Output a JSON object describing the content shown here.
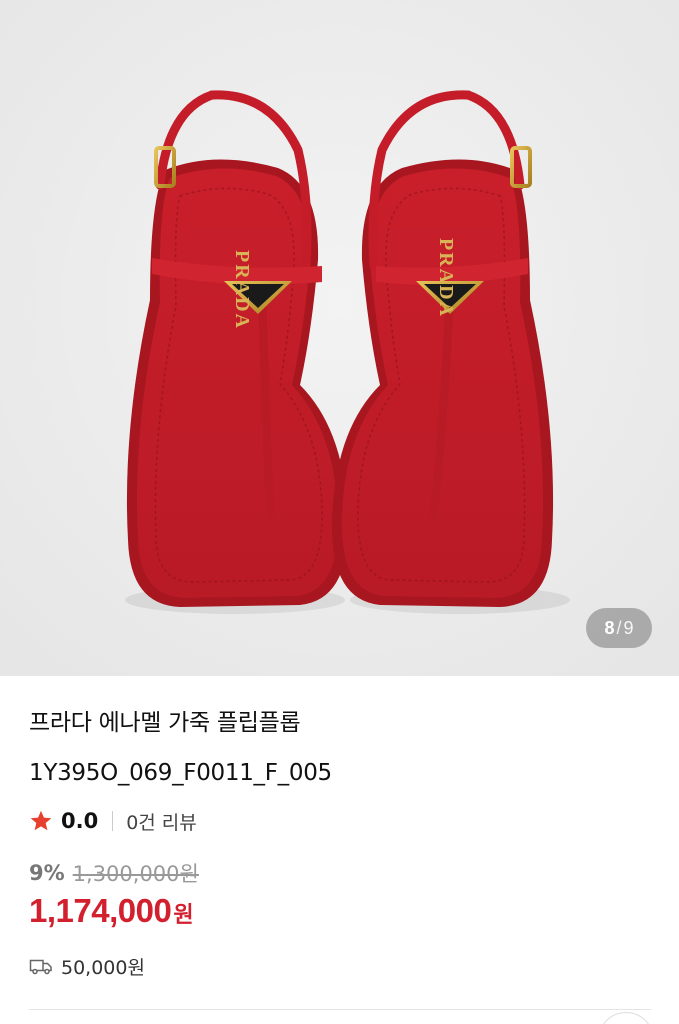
{
  "gallery": {
    "current": "8",
    "separator": "/",
    "total": "9",
    "image_icon": "sandals-photo",
    "logo_text": "PRADA"
  },
  "product": {
    "title_line1": "프라다 에나멜 가죽 플립플롭",
    "title_line2": "1Y395O_069_F0011_F_005",
    "rating": "0.0",
    "review_count": "0건 리뷰",
    "discount_percent": "9%",
    "original_price": "1,300,000원",
    "sale_price": "1,174,000",
    "currency": "원",
    "shipping_fee": "50,000원"
  },
  "colors": {
    "accent_red": "#d2202f",
    "star": "#e8402f",
    "sandal": "#c8202c"
  }
}
